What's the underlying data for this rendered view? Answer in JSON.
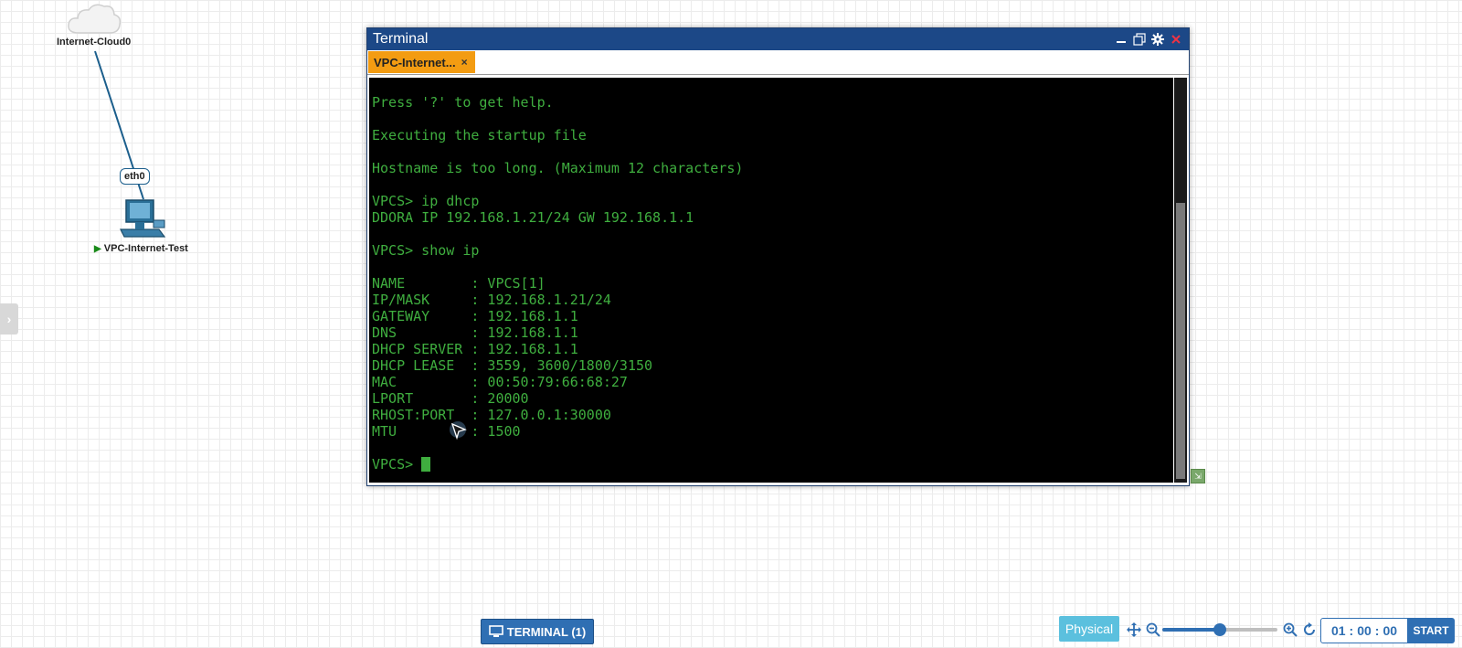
{
  "topology": {
    "cloud_label": "Internet-Cloud0",
    "interface_label": "eth0",
    "vpc_label": "VPC-Internet-Test",
    "vpc_status_color": "#1a8a1a"
  },
  "terminal": {
    "title": "Terminal",
    "tab_label": "VPC-Internet...",
    "tab_close": "×",
    "lines": [
      "Press '?' to get help.",
      "",
      "Executing the startup file",
      "",
      "Hostname is too long. (Maximum 12 characters)",
      "",
      "VPCS> ip dhcp",
      "DDORA IP 192.168.1.21/24 GW 192.168.1.1",
      "",
      "VPCS> show ip",
      "",
      "NAME        : VPCS[1]",
      "IP/MASK     : 192.168.1.21/24",
      "GATEWAY     : 192.168.1.1",
      "DNS         : 192.168.1.1",
      "DHCP SERVER : 192.168.1.1",
      "DHCP LEASE  : 3559, 3600/1800/3150",
      "MAC         : 00:50:79:66:68:27",
      "LPORT       : 20000",
      "RHOST:PORT  : 127.0.0.1:30000",
      "MTU         : 1500",
      ""
    ],
    "prompt": "VPCS> ",
    "text_color": "#3fae3f"
  },
  "toolbar": {
    "terminal_button": "TERMINAL (1)",
    "physical_button": "Physical",
    "zoom_level": 0.5,
    "timer": {
      "hours": "01",
      "minutes": "00",
      "seconds": "00",
      "sep": ":"
    },
    "start_button": "START"
  },
  "colors": {
    "accent": "#2f6fb3",
    "title_bar": "#1c4887",
    "tab": "#f39c12"
  }
}
